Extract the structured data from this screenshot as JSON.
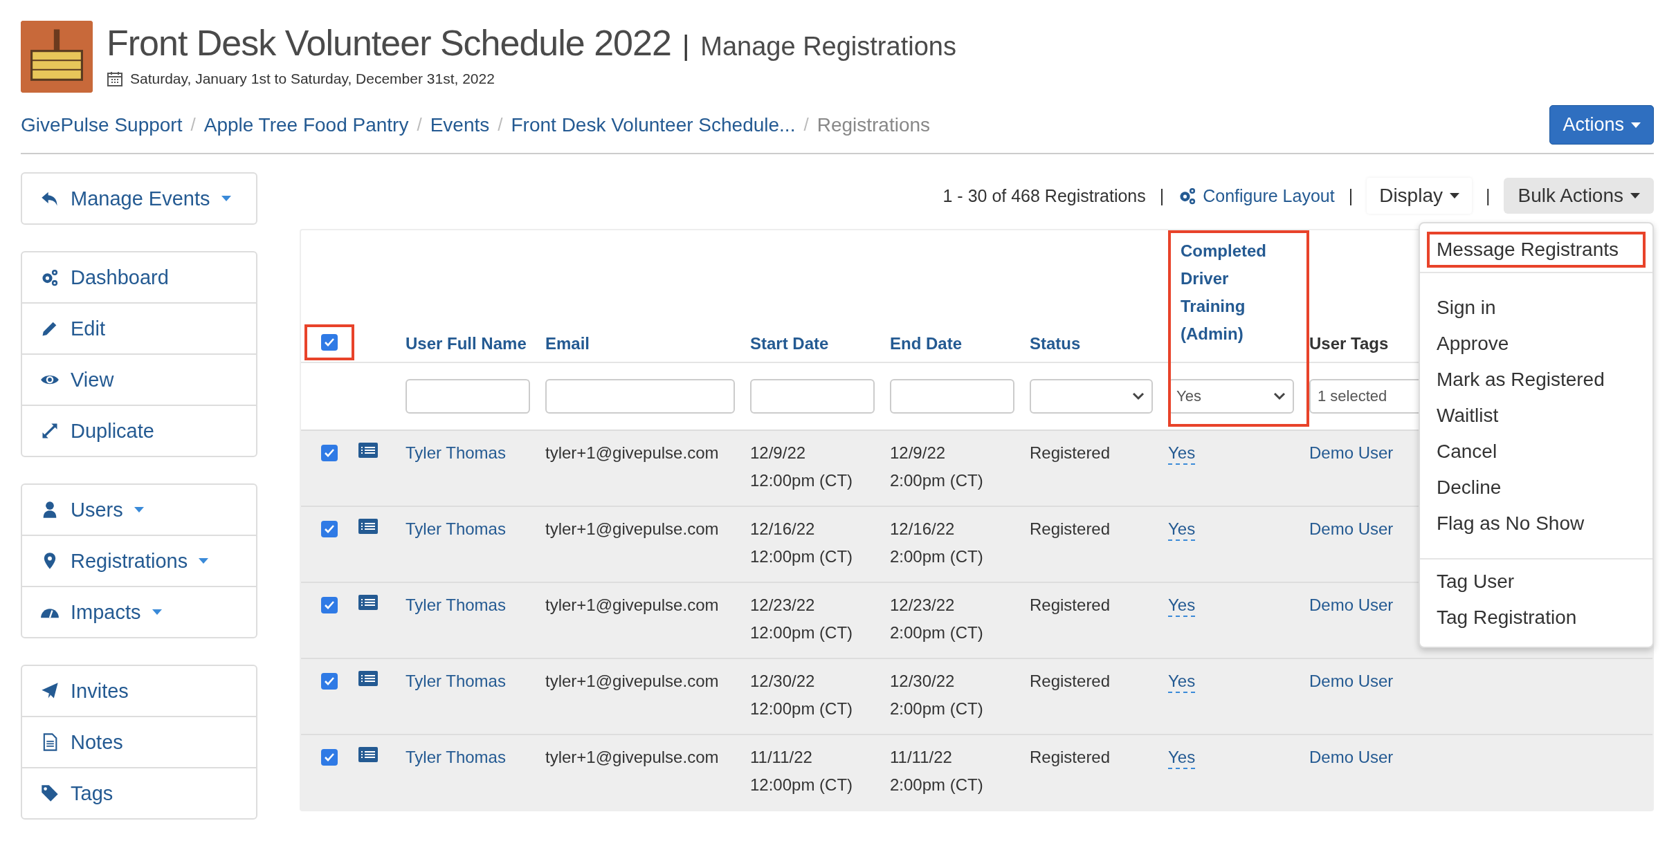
{
  "header": {
    "title": "Front Desk Volunteer Schedule 2022",
    "separator": "|",
    "subtitle": "Manage Registrations",
    "date": "Saturday, January 1st to Saturday, December 31st, 2022"
  },
  "breadcrumb": [
    {
      "label": "GivePulse Support",
      "current": false
    },
    {
      "separator": "/",
      "label": "Apple Tree Food Pantry",
      "current": false
    },
    {
      "separator": "/",
      "label": "Events",
      "current": false
    },
    {
      "separator": "/",
      "label": "Front Desk Volunteer Schedule...",
      "current": false
    },
    {
      "separator": "/",
      "label": "Registrations",
      "current": true
    }
  ],
  "actions_button": "Actions",
  "sidebar": {
    "groups": [
      [
        {
          "label": "Manage Events",
          "kind": "reply",
          "dropdown": true
        }
      ],
      [
        {
          "label": "Dashboard",
          "kind": "gears",
          "dropdown": false
        },
        {
          "label": "Edit",
          "kind": "pencil",
          "dropdown": false
        },
        {
          "label": "View",
          "kind": "eye",
          "dropdown": false
        },
        {
          "label": "Duplicate",
          "kind": "expand",
          "dropdown": false
        }
      ],
      [
        {
          "label": "Users",
          "kind": "user",
          "dropdown": true
        },
        {
          "label": "Registrations",
          "kind": "pin",
          "dropdown": true
        },
        {
          "label": "Impacts",
          "kind": "gauge",
          "dropdown": true
        }
      ],
      [
        {
          "label": "Invites",
          "kind": "plane",
          "dropdown": false
        },
        {
          "label": "Notes",
          "kind": "note",
          "dropdown": false
        },
        {
          "label": "Tags",
          "kind": "tag",
          "dropdown": false
        }
      ]
    ]
  },
  "toolbar": {
    "count": "1 - 30 of 468 Registrations",
    "separator_1": "|",
    "configure": "Configure Layout",
    "separator_2": "|",
    "display": "Display",
    "separator_3": "|",
    "bulk": "Bulk Actions"
  },
  "table": {
    "select_all": {
      "checked": true,
      "highlighted": true
    },
    "columns": [
      {
        "label": "User Full Name",
        "sortable": true,
        "highlighted": false,
        "filter": {
          "kind": "text"
        }
      },
      {
        "label": "Email",
        "sortable": true,
        "highlighted": false,
        "filter": {
          "kind": "text"
        }
      },
      {
        "label": "Start Date",
        "sortable": true,
        "highlighted": false,
        "filter": {
          "kind": "text"
        }
      },
      {
        "label": "End Date",
        "sortable": true,
        "highlighted": false,
        "filter": {
          "kind": "text"
        }
      },
      {
        "label": "Status",
        "sortable": true,
        "highlighted": false,
        "filter": {
          "kind": "select"
        }
      },
      {
        "label": "Completed Driver Training (Admin)",
        "sortable": true,
        "highlighted": true,
        "filter": {
          "kind": "select",
          "value": "Yes"
        }
      },
      {
        "label": "User Tags",
        "sortable": false,
        "highlighted": false,
        "filter": {
          "kind": "multi",
          "value": "1 selected"
        }
      }
    ],
    "rows": [
      {
        "checked": true,
        "name": "Tyler Thomas",
        "email": "tyler+1@givepulse.com",
        "start_date": "12/9/22",
        "start_time": "12:00pm (CT)",
        "end_date": "12/9/22",
        "end_time": "2:00pm (CT)",
        "status": "Registered",
        "completed": "Yes",
        "tags": "Demo User"
      },
      {
        "checked": true,
        "name": "Tyler Thomas",
        "email": "tyler+1@givepulse.com",
        "start_date": "12/16/22",
        "start_time": "12:00pm (CT)",
        "end_date": "12/16/22",
        "end_time": "2:00pm (CT)",
        "status": "Registered",
        "completed": "Yes",
        "tags": "Demo User"
      },
      {
        "checked": true,
        "name": "Tyler Thomas",
        "email": "tyler+1@givepulse.com",
        "start_date": "12/23/22",
        "start_time": "12:00pm (CT)",
        "end_date": "12/23/22",
        "end_time": "2:00pm (CT)",
        "status": "Registered",
        "completed": "Yes",
        "tags": "Demo User"
      },
      {
        "checked": true,
        "name": "Tyler Thomas",
        "email": "tyler+1@givepulse.com",
        "start_date": "12/30/22",
        "start_time": "12:00pm (CT)",
        "end_date": "12/30/22",
        "end_time": "2:00pm (CT)",
        "status": "Registered",
        "completed": "Yes",
        "tags": "Demo User"
      },
      {
        "checked": true,
        "name": "Tyler Thomas",
        "email": "tyler+1@givepulse.com",
        "start_date": "11/11/22",
        "start_time": "12:00pm (CT)",
        "end_date": "11/11/22",
        "end_time": "2:00pm (CT)",
        "status": "Registered",
        "completed": "Yes",
        "tags": "Demo User"
      }
    ]
  },
  "bulk_menu": {
    "sections": [
      [
        {
          "label": "Message Registrants",
          "highlighted": true
        }
      ],
      [
        {
          "label": "Sign in",
          "highlighted": false
        },
        {
          "label": "Approve",
          "highlighted": false
        },
        {
          "label": "Mark as Registered",
          "highlighted": false
        },
        {
          "label": "Waitlist",
          "highlighted": false
        },
        {
          "label": "Cancel",
          "highlighted": false
        },
        {
          "label": "Decline",
          "highlighted": false
        },
        {
          "label": "Flag as No Show",
          "highlighted": false
        }
      ],
      [
        {
          "label": "Tag User",
          "highlighted": false
        },
        {
          "label": "Tag Registration",
          "highlighted": false
        }
      ]
    ]
  }
}
